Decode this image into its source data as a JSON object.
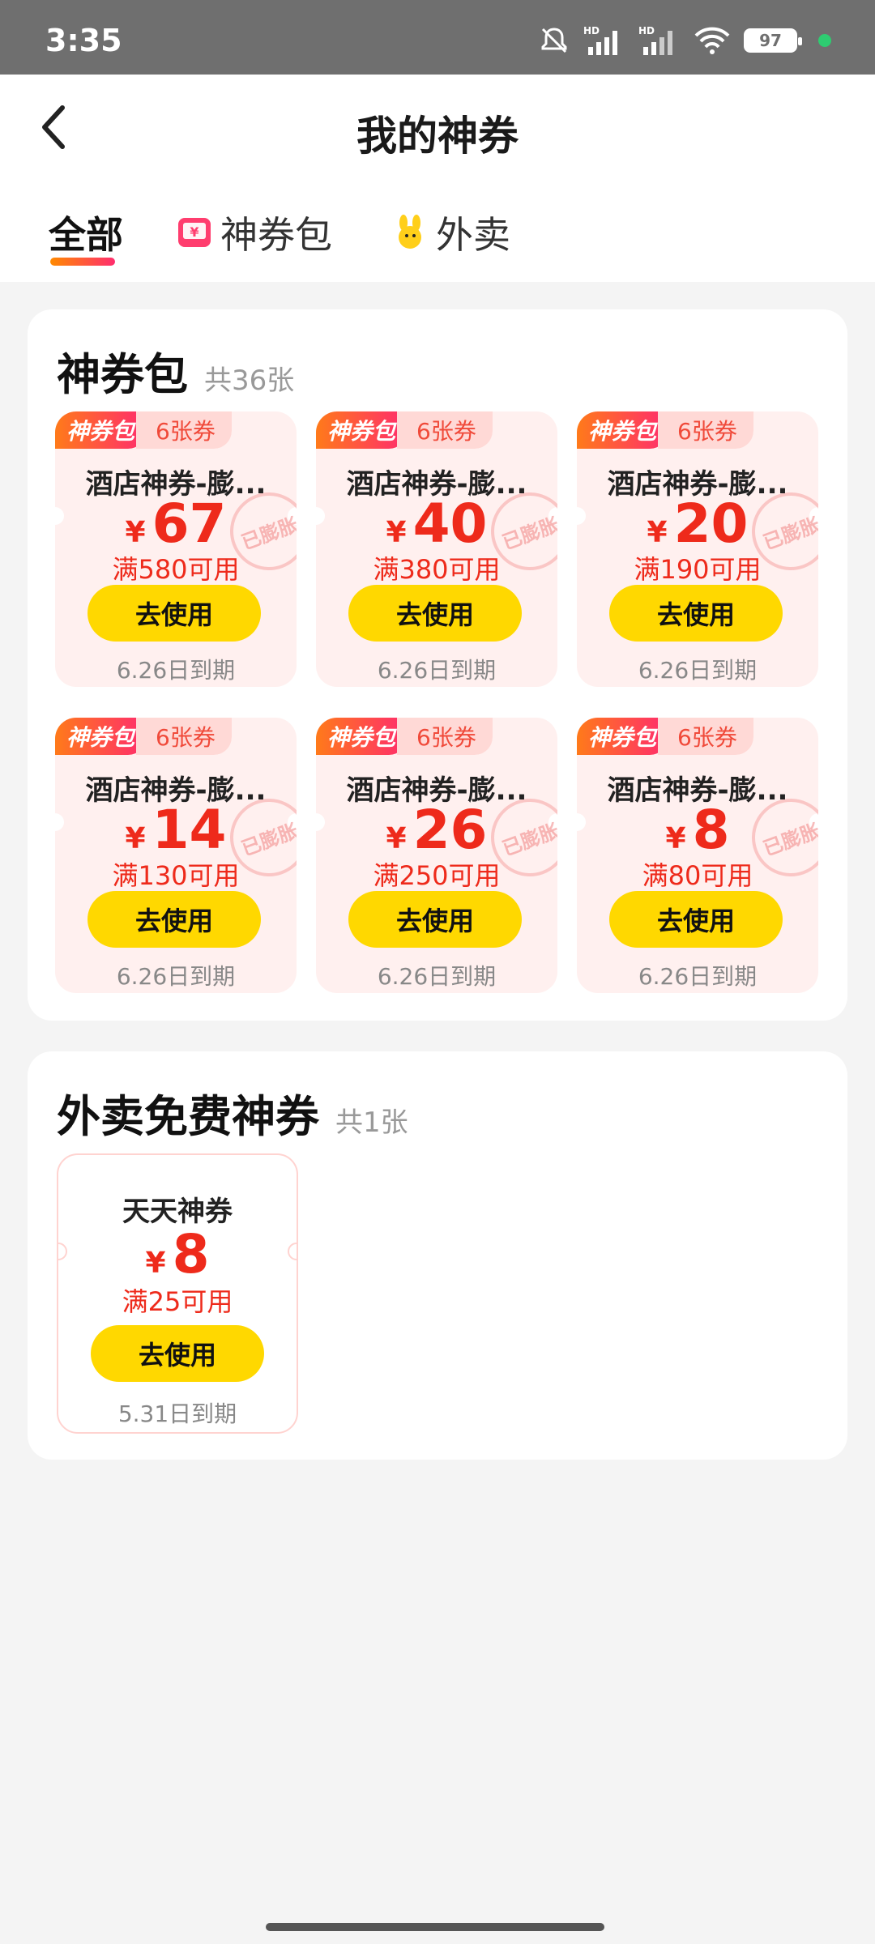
{
  "status_bar": {
    "time": "3:35",
    "battery": "97"
  },
  "header": {
    "title": "我的神券"
  },
  "tabs": [
    {
      "label": "全部",
      "active": true
    },
    {
      "label": "神券包",
      "icon": "coupon-bag-icon"
    },
    {
      "label": "外卖",
      "icon": "delivery-mascot-icon"
    }
  ],
  "section1": {
    "title": "神券包",
    "count": "共36张",
    "coupons": [
      {
        "tag": "神券包",
        "qty": "6张券",
        "title": "酒店神券-膨...",
        "yen": "¥",
        "amount": "67",
        "condition": "满580可用",
        "button": "去使用",
        "expire": "6.26日到期",
        "stamp": "已膨胀"
      },
      {
        "tag": "神券包",
        "qty": "6张券",
        "title": "酒店神券-膨...",
        "yen": "¥",
        "amount": "40",
        "condition": "满380可用",
        "button": "去使用",
        "expire": "6.26日到期",
        "stamp": "已膨胀"
      },
      {
        "tag": "神券包",
        "qty": "6张券",
        "title": "酒店神券-膨...",
        "yen": "¥",
        "amount": "20",
        "condition": "满190可用",
        "button": "去使用",
        "expire": "6.26日到期",
        "stamp": "已膨胀"
      },
      {
        "tag": "神券包",
        "qty": "6张券",
        "title": "酒店神券-膨...",
        "yen": "¥",
        "amount": "14",
        "condition": "满130可用",
        "button": "去使用",
        "expire": "6.26日到期",
        "stamp": "已膨胀"
      },
      {
        "tag": "神券包",
        "qty": "6张券",
        "title": "酒店神券-膨...",
        "yen": "¥",
        "amount": "26",
        "condition": "满250可用",
        "button": "去使用",
        "expire": "6.26日到期",
        "stamp": "已膨胀"
      },
      {
        "tag": "神券包",
        "qty": "6张券",
        "title": "酒店神券-膨...",
        "yen": "¥",
        "amount": "8",
        "condition": "满80可用",
        "button": "去使用",
        "expire": "6.26日到期",
        "stamp": "已膨胀"
      }
    ]
  },
  "section2": {
    "title": "外卖免费神券",
    "count": "共1张",
    "coupon": {
      "title": "天天神券",
      "yen": "¥",
      "amount": "8",
      "condition": "满25可用",
      "button": "去使用",
      "expire": "5.31日到期"
    }
  }
}
